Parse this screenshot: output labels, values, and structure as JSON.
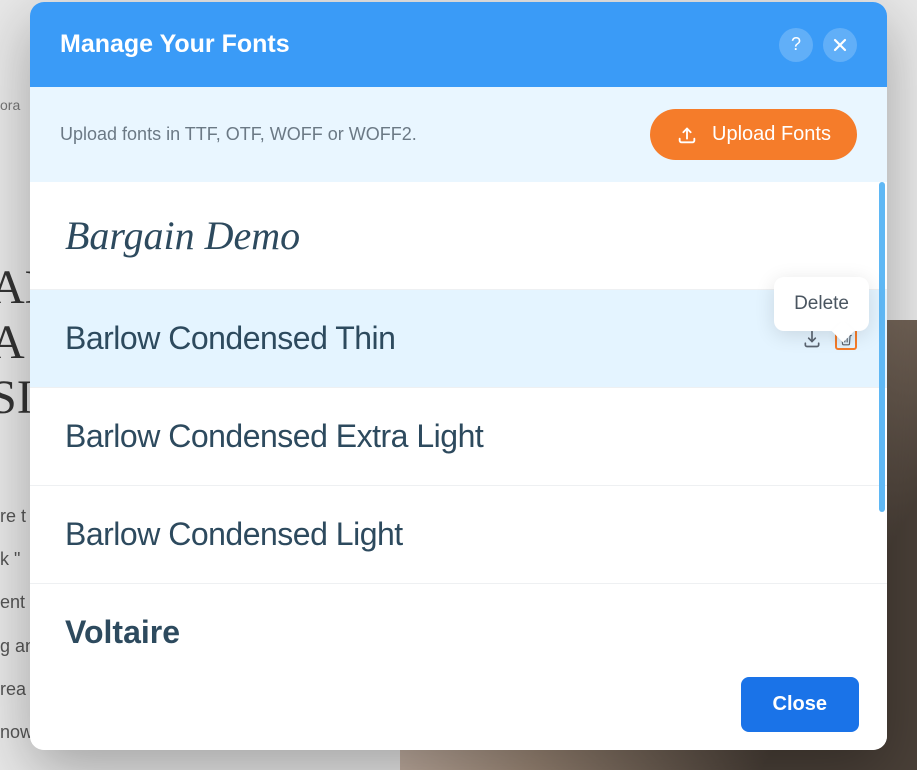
{
  "backdrop": {
    "topText": "ora",
    "bigText1": "AM",
    "bigText2": "A",
    "bigText3": "SI",
    "para1": "re t",
    "para2": "k \"",
    "para3": "ent",
    "para4": "g an",
    "para5": "rea",
    "para6": "now"
  },
  "modal": {
    "title": "Manage Your Fonts",
    "uploadHint": "Upload fonts in TTF, OTF, WOFF or WOFF2.",
    "uploadButton": "Upload Fonts",
    "closeButton": "Close",
    "tooltip": "Delete"
  },
  "fonts": [
    {
      "name": "Bargain Demo",
      "style": "script",
      "selected": false
    },
    {
      "name": "Barlow Condensed Thin",
      "style": "thin",
      "selected": true
    },
    {
      "name": "Barlow Condensed Extra Light",
      "style": "extralight",
      "selected": false
    },
    {
      "name": "Barlow Condensed Light",
      "style": "light",
      "selected": false
    },
    {
      "name": "Voltaire",
      "style": "voltaire",
      "selected": false
    }
  ]
}
